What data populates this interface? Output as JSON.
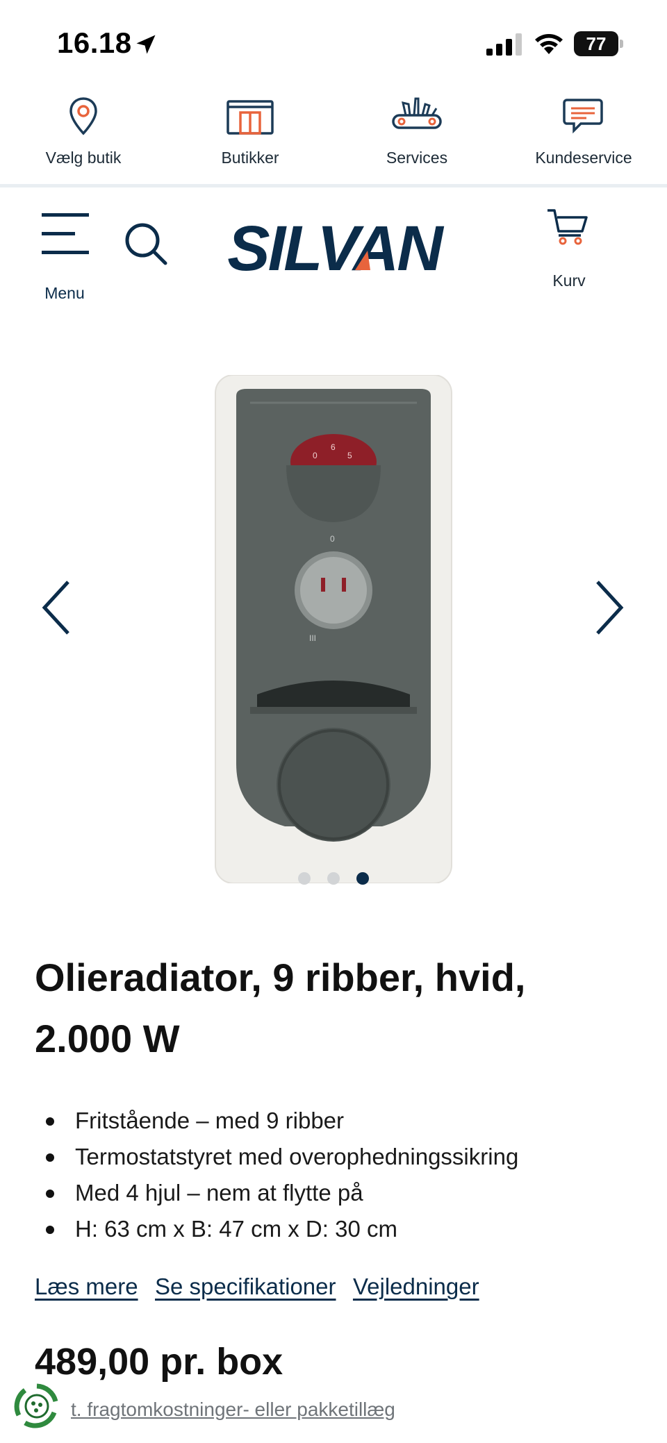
{
  "status_bar": {
    "time": "16.18",
    "battery": "77"
  },
  "util_nav": {
    "items": [
      {
        "label": "Vælg butik",
        "icon": "location-pin-icon"
      },
      {
        "label": "Butikker",
        "icon": "store-icon"
      },
      {
        "label": "Services",
        "icon": "tools-icon"
      },
      {
        "label": "Kundeservice",
        "icon": "chat-icon"
      }
    ]
  },
  "header": {
    "menu_label": "Menu",
    "logo_text": "SILVAN",
    "cart_label": "Kurv"
  },
  "carousel": {
    "image": "oil-radiator-product",
    "dot_count": 3,
    "active_index": 3
  },
  "product": {
    "title": "Olieradiator, 9 ribber, hvid, 2.000 W",
    "features": [
      "Fritstående – med 9 ribber",
      "Termostatstyret med overophedningssikring",
      "Med 4 hjul – nem at flytte på",
      "H: 63 cm x B: 47 cm x D: 30 cm"
    ],
    "links": [
      "Læs mere",
      "Se specifikationer",
      "Vejledninger"
    ],
    "price": "489,00 pr. box",
    "shipping_note": "t. fragtomkostninger- eller pakketillæg"
  },
  "colors": {
    "brand_navy": "#0b2c4a",
    "accent_orange": "#e8643c"
  }
}
